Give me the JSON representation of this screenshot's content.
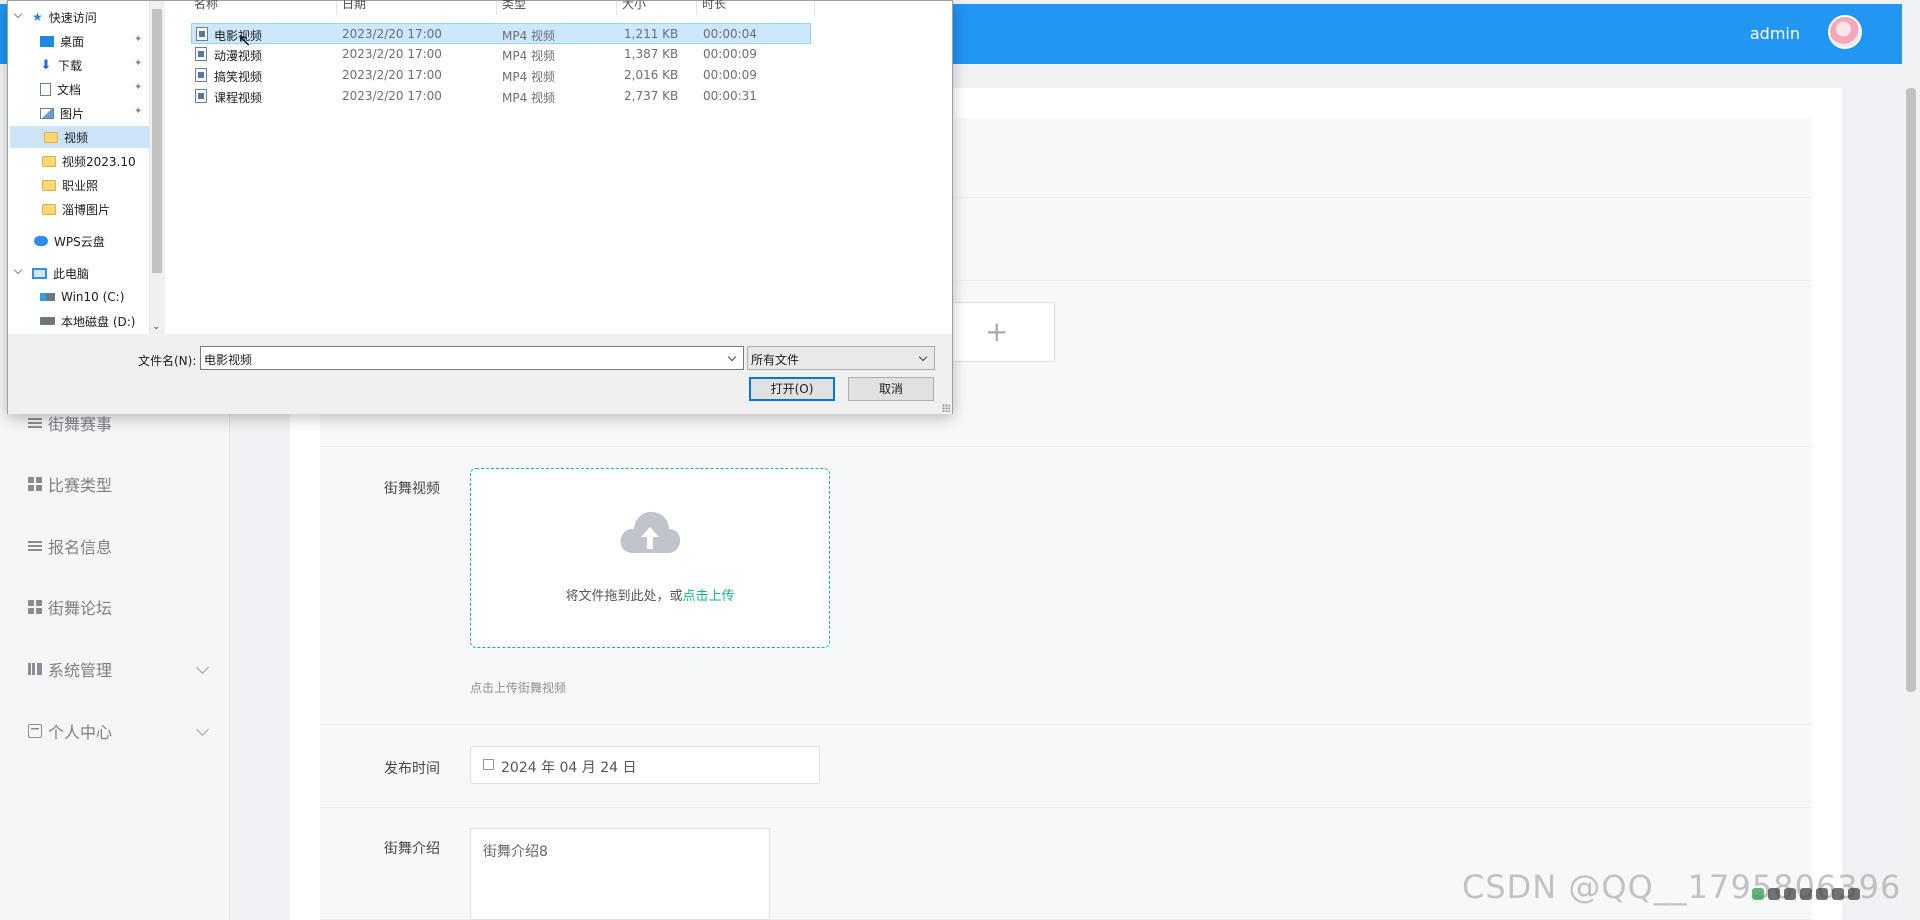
{
  "header": {
    "username": "admin"
  },
  "sidebar": {
    "items": [
      {
        "label": "街舞赛事"
      },
      {
        "label": "比赛类型"
      },
      {
        "label": "报名信息"
      },
      {
        "label": "街舞论坛"
      },
      {
        "label": "系统管理"
      },
      {
        "label": "个人中心"
      }
    ]
  },
  "form": {
    "video_label": "街舞视频",
    "upload_text": "将文件拖到此处，或",
    "upload_link": "点击上传",
    "upload_hint": "点击上传街舞视频",
    "image_add_glyph": "+",
    "date_label": "发布时间",
    "date_value": "2024 年 04 月 24 日",
    "intro_label": "街舞介绍",
    "intro_value": "街舞介绍8"
  },
  "dialog": {
    "nav": [
      {
        "label": "快速访问",
        "icon": "star-icon"
      },
      {
        "label": "桌面",
        "icon": "desktop-icon",
        "pinned": true
      },
      {
        "label": "下载",
        "icon": "download-icon",
        "pinned": true
      },
      {
        "label": "文档",
        "icon": "document-icon",
        "pinned": true
      },
      {
        "label": "图片",
        "icon": "picture-icon",
        "pinned": true
      },
      {
        "label": "视频",
        "icon": "folder-icon",
        "selected": true
      },
      {
        "label": "视频2023.10",
        "icon": "folder-icon"
      },
      {
        "label": "职业照",
        "icon": "folder-icon"
      },
      {
        "label": "淄博图片",
        "icon": "folder-icon"
      },
      {
        "label": "WPS云盘",
        "icon": "cloud-icon"
      },
      {
        "label": "此电脑",
        "icon": "computer-icon"
      },
      {
        "label": "Win10 (C:)",
        "icon": "drive-icon"
      },
      {
        "label": "本地磁盘 (D:)",
        "icon": "drive-icon"
      }
    ],
    "columns": [
      "名称",
      "日期",
      "类型",
      "大小",
      "时长"
    ],
    "files": [
      {
        "name": "电影视频",
        "date": "2023/2/20 17:00",
        "type": "MP4 视频",
        "size": "1,211 KB",
        "duration": "00:00:04",
        "selected": true
      },
      {
        "name": "动漫视频",
        "date": "2023/2/20 17:00",
        "type": "MP4 视频",
        "size": "1,387 KB",
        "duration": "00:00:09"
      },
      {
        "name": "搞笑视频",
        "date": "2023/2/20 17:00",
        "type": "MP4 视频",
        "size": "2,016 KB",
        "duration": "00:00:09"
      },
      {
        "name": "课程视频",
        "date": "2023/2/20 17:00",
        "type": "MP4 视频",
        "size": "2,737 KB",
        "duration": "00:00:31"
      }
    ],
    "filename_label": "文件名(N):",
    "filename_value": "电影视频",
    "filetype_value": "所有文件",
    "open_label": "打开(O)",
    "cancel_label": "取消"
  },
  "watermark": "CSDN @QQ__1795806396",
  "colors": {
    "topbar": "#2196f3",
    "accent_green": "#19b38a",
    "dialog_selection": "#cce8ff"
  }
}
